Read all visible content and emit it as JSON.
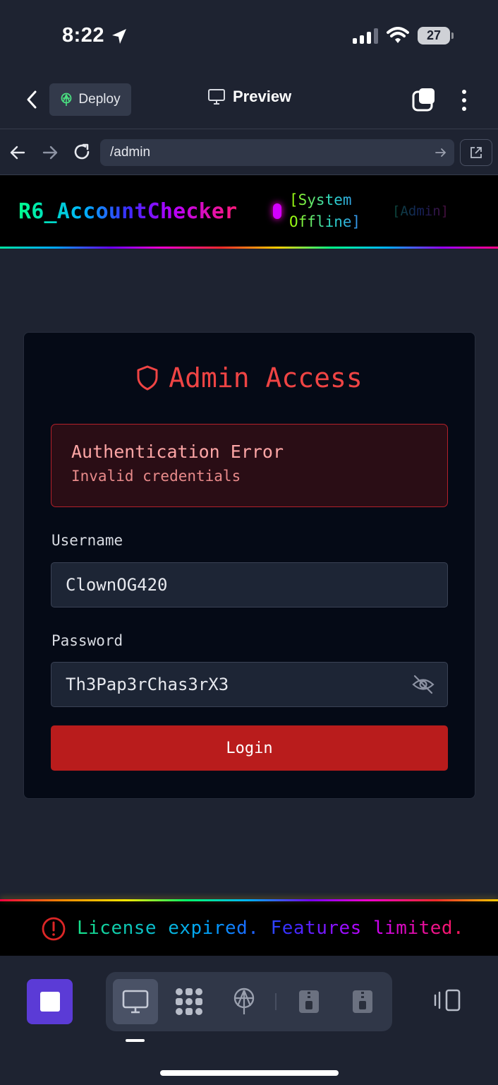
{
  "status_bar": {
    "time": "8:22",
    "battery": "27"
  },
  "app_header": {
    "deploy_label": "Deploy",
    "preview_label": "Preview"
  },
  "browser": {
    "url": "/admin"
  },
  "site": {
    "logo": "R6_AccountChecker",
    "system_status": "[System Offline]",
    "admin_tag": "[Admin]"
  },
  "login": {
    "title": "Admin Access",
    "error_title": "Authentication Error",
    "error_message": "Invalid credentials",
    "username_label": "Username",
    "username_value": "ClownOG420",
    "password_label": "Password",
    "password_value": "Th3Pap3rChas3rX3",
    "login_label": "Login"
  },
  "license": {
    "message": "License expired. Features limited."
  },
  "colors": {
    "accent_red": "#ef4444",
    "login_button": "#b91c1c",
    "stop_button": "#5b3bd6",
    "background": "#1e2331"
  },
  "icons": {
    "toolbar": [
      "monitor-icon",
      "apps-grid-icon",
      "deploy-icon",
      "zip-icon",
      "zip-icon",
      "split-view-icon"
    ]
  }
}
